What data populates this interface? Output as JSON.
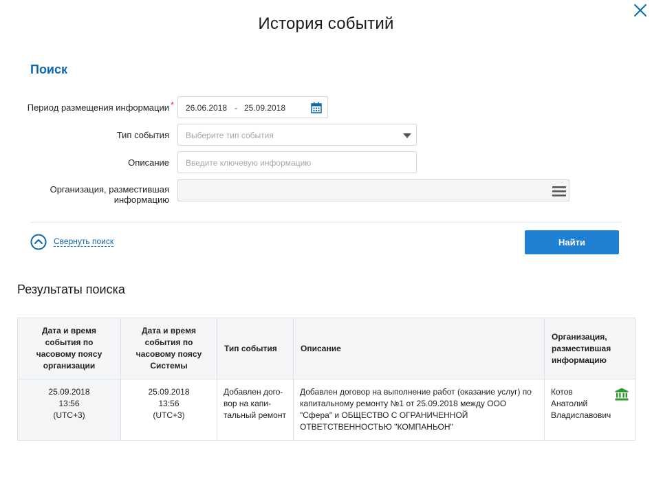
{
  "dialog": {
    "title": "История событий"
  },
  "search": {
    "heading": "Поиск",
    "period_label": "Период размещения информации",
    "required_mark": "*",
    "date_from": "26.06.2018",
    "date_sep": "-",
    "date_to": "25.09.2018",
    "event_type_label": "Тип события",
    "event_type_placeholder": "Выберите тип события",
    "description_label": "Описание",
    "description_placeholder": "Введите ключевую информацию",
    "org_label_line1": "Организация, разместившая",
    "org_label_line2": "информацию",
    "org_value": "",
    "collapse_label": "Свернуть поиск",
    "find_button": "Найти"
  },
  "results": {
    "heading": "Результаты поиска",
    "columns": {
      "org_time": [
        "Дата и время",
        "события по",
        "часовому поясу",
        "организации"
      ],
      "sys_time": [
        "Дата и время",
        "события по",
        "часовому поясу",
        "Системы"
      ],
      "event_type": "Тип события",
      "description": "Описание",
      "organization": [
        "Организация,",
        "разместившая",
        "информацию"
      ]
    },
    "rows": [
      {
        "org_time": [
          "25.09.2018",
          "13:56",
          "(UTC+3)"
        ],
        "sys_time": [
          "25.09.2018",
          "13:56",
          "(UTC+3)"
        ],
        "event_type": [
          "Добавлен дого-",
          "вор на капи-",
          "тальный ремонт"
        ],
        "description": [
          "Добавлен договор на выполнение работ (оказание услуг) по",
          "капитальному ремонту №1 от 25.09.2018 между ООО",
          "\"Сфера\" и ОБЩЕСТВО С ОГРАНИЧЕННОЙ",
          "ОТВЕТСТВЕННОСТЬЮ \"КОМПАНЬОН\""
        ],
        "organization": [
          "Котов",
          "Анатолий",
          "Владиславович"
        ],
        "org_icon": "government-building-icon"
      }
    ]
  },
  "colors": {
    "accent": "#0c69ad",
    "button": "#1f7fd2",
    "required": "#d9332b",
    "gov_icon": "#2e9a2e"
  }
}
